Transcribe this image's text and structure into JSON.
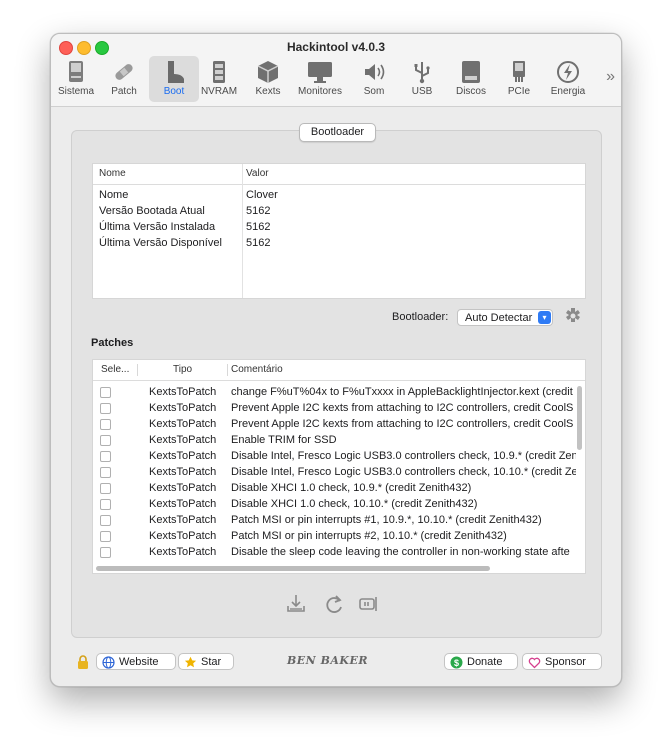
{
  "window": {
    "title": "Hackintool v4.0.3"
  },
  "toolbar": {
    "items": [
      {
        "label": "Sistema",
        "icon": "system-icon"
      },
      {
        "label": "Patch",
        "icon": "bandaid-icon"
      },
      {
        "label": "Boot",
        "icon": "boot-icon"
      },
      {
        "label": "NVRAM",
        "icon": "chip-icon"
      },
      {
        "label": "Kexts",
        "icon": "cube-icon"
      },
      {
        "label": "Monitores",
        "icon": "monitor-icon"
      },
      {
        "label": "Som",
        "icon": "speaker-icon"
      },
      {
        "label": "USB",
        "icon": "usb-icon"
      },
      {
        "label": "Discos",
        "icon": "disk-icon"
      },
      {
        "label": "PCIe",
        "icon": "pcie-icon"
      },
      {
        "label": "Energia",
        "icon": "power-icon"
      }
    ],
    "active": "Boot",
    "more": "»"
  },
  "bootloader_tab": "Bootloader",
  "info_table": {
    "headers": [
      "Nome",
      "Valor"
    ],
    "rows": [
      [
        "Nome",
        "Clover"
      ],
      [
        "Versão Bootada Atual",
        "5162"
      ],
      [
        "Última Versão Instalada",
        "5162"
      ],
      [
        "Última Versão Disponível",
        "5162"
      ]
    ]
  },
  "bootloader_select": {
    "label": "Bootloader:",
    "value": "Auto Detectar"
  },
  "patches": {
    "title": "Patches",
    "headers": [
      "Sele...",
      "Tipo",
      "Comentário"
    ],
    "rows": [
      {
        "tipo": "KextsToPatch",
        "comentario": "change F%uT%04x to F%uTxxxx in AppleBacklightInjector.kext (credit"
      },
      {
        "tipo": "KextsToPatch",
        "comentario": "Prevent Apple I2C kexts from attaching to I2C controllers, credit CoolS"
      },
      {
        "tipo": "KextsToPatch",
        "comentario": "Prevent Apple I2C kexts from attaching to I2C controllers, credit CoolS"
      },
      {
        "tipo": "KextsToPatch",
        "comentario": "Enable TRIM for SSD"
      },
      {
        "tipo": "KextsToPatch",
        "comentario": "Disable Intel, Fresco Logic USB3.0 controllers check, 10.9.* (credit Zen"
      },
      {
        "tipo": "KextsToPatch",
        "comentario": "Disable Intel, Fresco Logic USB3.0 controllers check, 10.10.* (credit Ze"
      },
      {
        "tipo": "KextsToPatch",
        "comentario": "Disable XHCI 1.0 check, 10.9.* (credit Zenith432)"
      },
      {
        "tipo": "KextsToPatch",
        "comentario": "Disable XHCI 1.0 check, 10.10.* (credit Zenith432)"
      },
      {
        "tipo": "KextsToPatch",
        "comentario": "Patch MSI or pin interrupts #1, 10.9.*, 10.10.* (credit Zenith432)"
      },
      {
        "tipo": "KextsToPatch",
        "comentario": "Patch MSI or pin interrupts #2, 10.10.* (credit Zenith432)"
      },
      {
        "tipo": "KextsToPatch",
        "comentario": "Disable the sleep code leaving the controller in non-working state afte"
      }
    ]
  },
  "footer": {
    "website": "Website",
    "star": "Star",
    "brand": "BEN BAKER",
    "donate": "Donate",
    "sponsor": "Sponsor"
  }
}
